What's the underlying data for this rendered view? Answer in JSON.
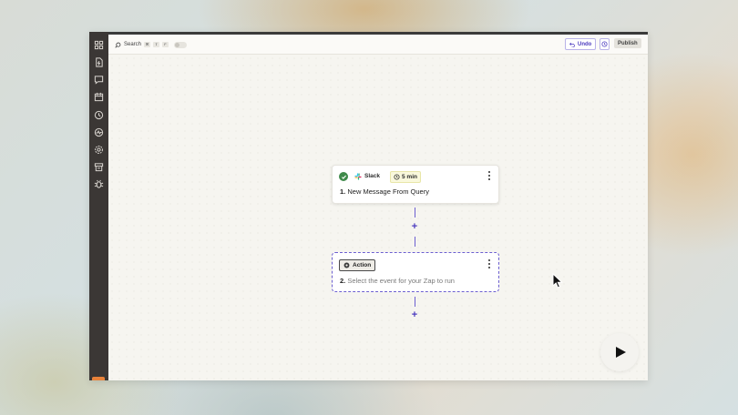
{
  "topbar": {
    "search_label": "Search",
    "search_keys": [
      "⌘",
      "⇧",
      "F"
    ],
    "undo_label": "Undo",
    "publish_label": "Publish"
  },
  "sidebar": {
    "icons": [
      "apps-icon",
      "zap-file-icon",
      "chat-icon",
      "calendar-icon",
      "history-icon",
      "activity-icon",
      "settings-icon",
      "archive-icon",
      "bug-icon"
    ]
  },
  "steps": [
    {
      "number": "1.",
      "app": "Slack",
      "delay": "5 min",
      "title": "New Message From Query",
      "status": "complete"
    },
    {
      "number": "2.",
      "chip_label": "Action",
      "title": "Select the event for your Zap to run"
    }
  ],
  "colors": {
    "accent": "#6c5fd0",
    "success": "#3f8a4a",
    "sidebar": "#3b3735"
  }
}
